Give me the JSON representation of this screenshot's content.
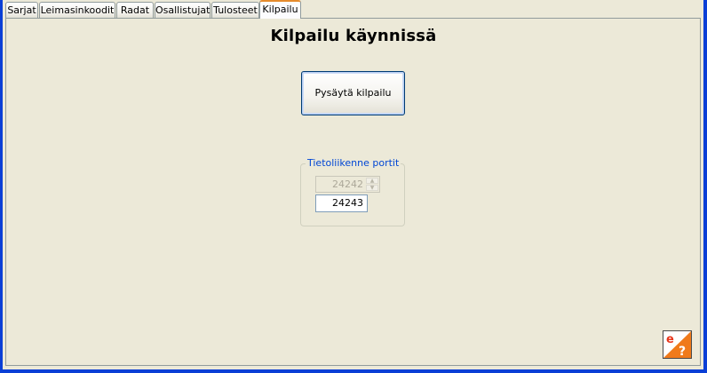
{
  "tabs": [
    {
      "label": "Sarjat"
    },
    {
      "label": "Leimasinkoodit"
    },
    {
      "label": "Radat"
    },
    {
      "label": "Osallistujat"
    },
    {
      "label": "Tulosteet"
    },
    {
      "label": "Kilpailu",
      "active": true
    }
  ],
  "main": {
    "title": "Kilpailu käynnissä",
    "stop_button_label": "Pysäytä kilpailu"
  },
  "ports": {
    "group_label": "Tietoliikenne portit",
    "port_disabled_value": "24242",
    "port_value": "24243"
  },
  "colors": {
    "window_frame": "#0a3fd6",
    "panel_background": "#ece9d8",
    "active_tab_accent": "#e68b2c",
    "group_label": "#0046d5"
  },
  "icons": {
    "logo": "orienteering-help-logo"
  }
}
